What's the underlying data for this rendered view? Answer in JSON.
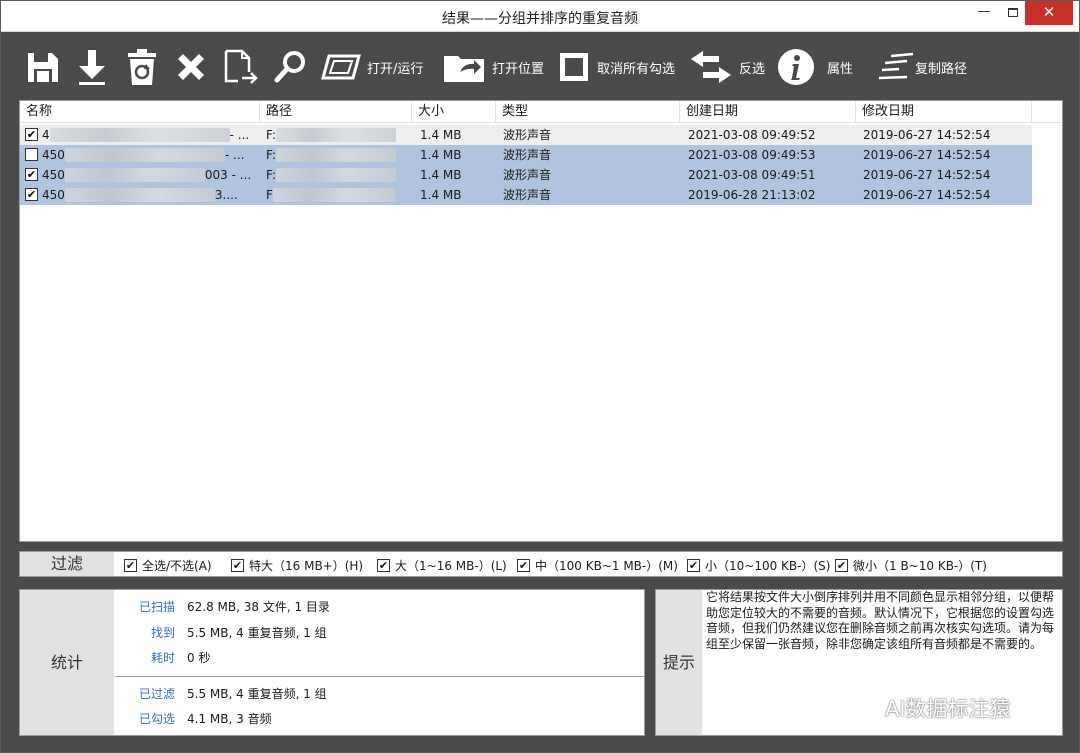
{
  "window": {
    "title": "结果——分组并排序的重复音频",
    "min_glyph": "—",
    "close_glyph": "✕"
  },
  "toolbar": {
    "open_run_label": "打开/运行",
    "open_location_label": "打开位置",
    "uncheck_all_label": "取消所有勾选",
    "invert_label": "反选",
    "properties_label": "属性",
    "copy_path_label": "复制路径"
  },
  "columns": [
    "名称",
    "路径",
    "大小",
    "类型",
    "创建日期",
    "修改日期"
  ],
  "rows": [
    {
      "checked": "✔",
      "name_prefix": "4",
      "name_suffix": "- ...",
      "path_prefix": "F:",
      "size": "1.4 MB",
      "type": "波形声音",
      "created": "2021-03-08 09:49:52",
      "modified": "2019-06-27 14:52:54"
    },
    {
      "checked": "",
      "name_prefix": "450",
      "name_suffix": "- ...",
      "path_prefix": "F:",
      "size": "1.4 MB",
      "type": "波形声音",
      "created": "2021-03-08 09:49:53",
      "modified": "2019-06-27 14:52:54"
    },
    {
      "checked": "✔",
      "name_prefix": "450",
      "name_suffix": "003 - ...",
      "path_prefix": "F:",
      "size": "1.4 MB",
      "type": "波形声音",
      "created": "2021-03-08 09:49:51",
      "modified": "2019-06-27 14:52:54"
    },
    {
      "checked": "✔",
      "name_prefix": "450",
      "name_suffix": "3....",
      "path_prefix": "F",
      "size": "1.4 MB",
      "type": "波形声音",
      "created": "2019-06-28 21:13:02",
      "modified": "2019-06-27 14:52:54"
    }
  ],
  "filter": {
    "label": "过滤",
    "items": [
      {
        "checked": "✔",
        "label": "全选/不选(A)"
      },
      {
        "checked": "✔",
        "label": "特大（16 MB+）(H)"
      },
      {
        "checked": "✔",
        "label": "大（1~16 MB-）(L)"
      },
      {
        "checked": "✔",
        "label": "中（100 KB~1 MB-）(M)"
      },
      {
        "checked": "✔",
        "label": "小（10~100 KB-）(S)"
      },
      {
        "checked": "✔",
        "label": "微小（1 B~10 KB-）(T)"
      }
    ]
  },
  "stats": {
    "label": "统计",
    "scanned_key": "已扫描",
    "scanned_val": "62.8 MB, 38 文件, 1 目录",
    "found_key": "找到",
    "found_val": "5.5 MB, 4 重复音频, 1 组",
    "time_key": "耗时",
    "time_val": "0 秒",
    "filtered_key": "已过滤",
    "filtered_val": "5.5 MB, 4 重复音频, 1 组",
    "checked_key": "已勾选",
    "checked_val": "4.1 MB, 3 音频"
  },
  "hint": {
    "label": "提示",
    "text": "它将结果按文件大小倒序排列并用不同颜色显示相邻分组，以便帮助您定位较大的不需要的音频。默认情况下，它根据您的设置勾选音频，但我们仍然建议您在删除音频之前再次核实勾选项。请为每组至少保留一张音频，除非您确定该组所有音频都是不需要的。"
  },
  "watermark": "AI数据标注猿",
  "colors": {
    "toolbar_bg": "#4a4a4a",
    "selected_row": "#b1c4df",
    "stat_key": "#2f6cc4",
    "close_button": "#c7312a"
  }
}
